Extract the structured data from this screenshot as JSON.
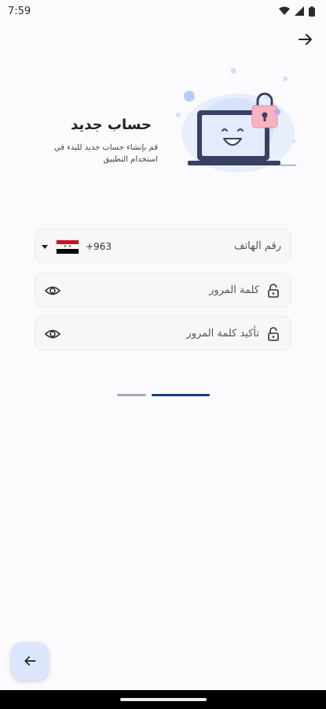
{
  "status_bar": {
    "time": "7:59",
    "icons": [
      "wifi-icon",
      "signal-icon",
      "battery-icon"
    ]
  },
  "header": {
    "next_icon": "arrow-right-icon"
  },
  "hero": {
    "title": "حساب جديد",
    "subtitle": "قم بإنشاء حساب جديد للبدء في استخدام التطبيق",
    "illustration": "laptop-lock-illustration"
  },
  "form": {
    "phone": {
      "label": "رقم الهاتف",
      "country_code": "+963",
      "flag": "syria-flag"
    },
    "password": {
      "label": "كلمة المرور"
    },
    "confirm_password": {
      "label": "تأكيد كلمة المرور"
    }
  },
  "pager": {
    "page_count": 2,
    "active_index": 1
  },
  "footer": {
    "back_icon": "arrow-left-icon"
  },
  "colors": {
    "background": "#fbfbfe",
    "accent": "#1f3a8f",
    "fab_bg": "#dbe5fb"
  }
}
